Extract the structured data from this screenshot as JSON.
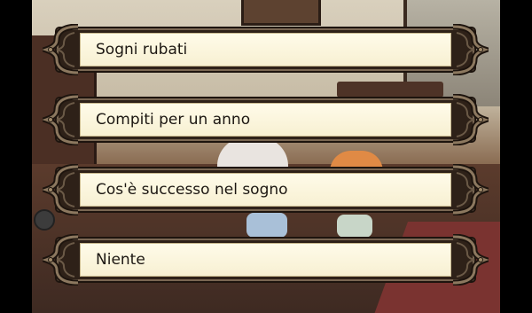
{
  "dialogue": {
    "options": [
      {
        "label": "Sogni rubati"
      },
      {
        "label": "Compiti per un anno"
      },
      {
        "label": "Cos'è successo nel sogno"
      },
      {
        "label": "Niente"
      }
    ]
  },
  "colors": {
    "panel": "#f7f0d2",
    "frame": "#2e2118",
    "text": "#1c1712"
  },
  "icons": {
    "choice_ornament": "ornate-bracket-icon"
  }
}
